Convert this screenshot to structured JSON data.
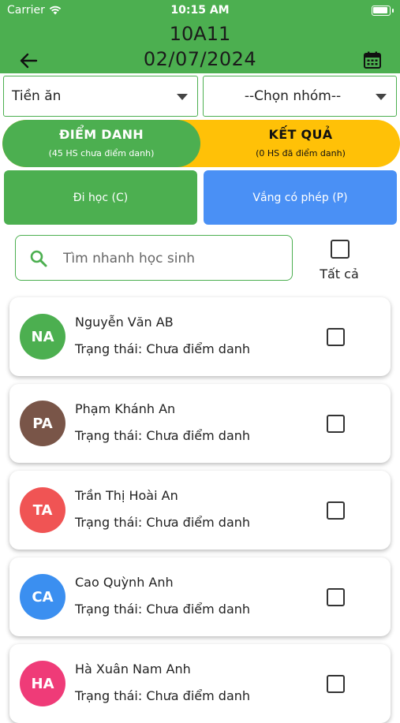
{
  "status_bar": {
    "carrier": "Carrier",
    "time": "10:15 AM"
  },
  "header": {
    "class_name": "10A11",
    "date": "02/07/2024",
    "color": "#4caf50"
  },
  "filters": {
    "category": "Tiền ăn",
    "group_placeholder": "--Chọn nhóm--"
  },
  "tabs": {
    "attendance": {
      "title": "ĐIỂM DANH",
      "subtitle": "(45 HS chưa điểm danh)",
      "color": "#4caf50"
    },
    "result": {
      "title": "KẾT QUẢ",
      "subtitle": "(0 HS đã điểm danh)",
      "color": "#ffc107"
    }
  },
  "actions": {
    "present": {
      "label": "Đi học (C)",
      "color": "#4caf50"
    },
    "absent": {
      "label": "Vắng có phép (P)",
      "color": "#4a90f5"
    }
  },
  "search": {
    "placeholder": "Tìm nhanh học sinh"
  },
  "select_all": {
    "label": "Tất cả"
  },
  "students": [
    {
      "initials": "NA",
      "name": "Nguyễn Văn AB",
      "status": "Trạng thái: Chưa điểm danh",
      "color": "#4caf50"
    },
    {
      "initials": "PA",
      "name": "Phạm Khánh An",
      "status": "Trạng thái: Chưa điểm danh",
      "color": "#795548"
    },
    {
      "initials": "TA",
      "name": "Trần Thị Hoài An",
      "status": "Trạng thái: Chưa điểm danh",
      "color": "#f05454"
    },
    {
      "initials": "CA",
      "name": "Cao Quỳnh Anh",
      "status": "Trạng thái: Chưa điểm danh",
      "color": "#3b8ff0"
    },
    {
      "initials": "HA",
      "name": "Hà Xuân Nam Anh",
      "status": "Trạng thái: Chưa điểm danh",
      "color": "#ef3b78"
    }
  ]
}
